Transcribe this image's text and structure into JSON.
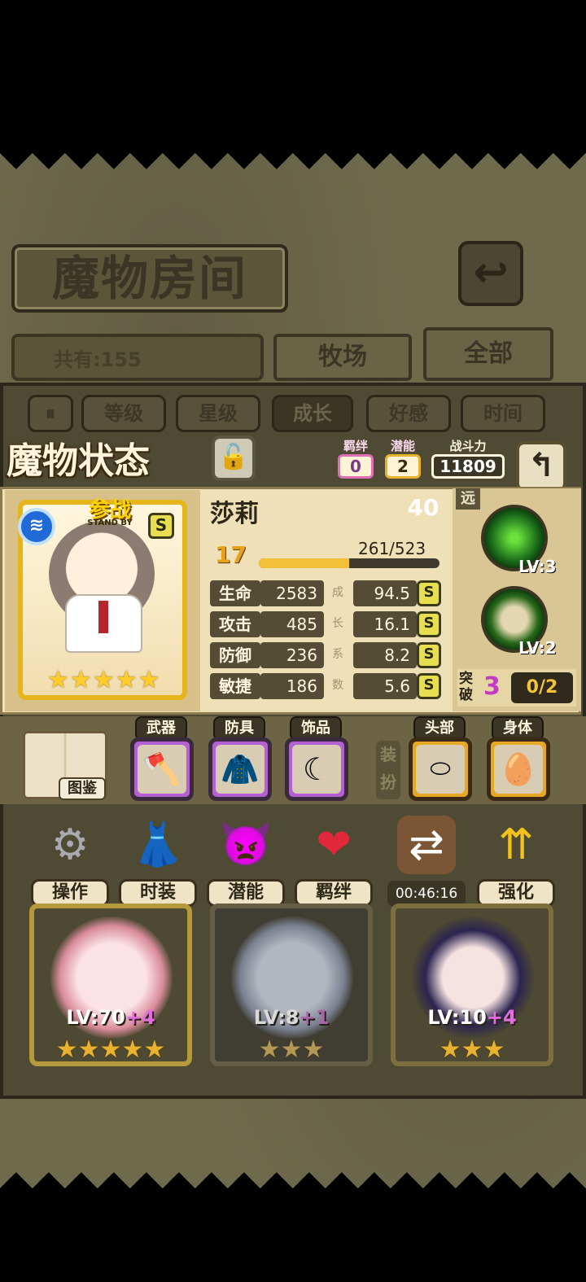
{
  "header": {
    "title": "魔物房间",
    "total_label": "共有:155",
    "tabs": [
      "牧场",
      "全部"
    ]
  },
  "sort_tabs": [
    "等级",
    "星级",
    "成长",
    "好感",
    "时间"
  ],
  "status": {
    "title": "魔物状态",
    "bond_label": "羁绊",
    "bond_value": "0",
    "potential_label": "潜能",
    "potential_value": "2",
    "power_label": "战斗力",
    "power_value": "11809"
  },
  "monster": {
    "standby_label": "参战",
    "standby_sub": "STAND BY",
    "element_icon": "water-icon",
    "rank": "S",
    "stars": 5,
    "name": "莎莉",
    "level": "40",
    "sub_level": "17",
    "exp_text": "261/523",
    "exp_progress": 0.5,
    "stats": [
      {
        "label": "生命",
        "value": "2583",
        "growth": "94.5",
        "grade": "S",
        "note": "成"
      },
      {
        "label": "攻击",
        "value": "485",
        "growth": "16.1",
        "grade": "S",
        "note": "长"
      },
      {
        "label": "防御",
        "value": "236",
        "growth": "8.2",
        "grade": "S",
        "note": "系"
      },
      {
        "label": "敏捷",
        "value": "186",
        "growth": "5.6",
        "grade": "S",
        "note": "数"
      }
    ],
    "range_label": "远",
    "skills": [
      {
        "name": "green-orb-skill",
        "level": "LV:3"
      },
      {
        "name": "drum-skill",
        "level": "LV:2"
      }
    ],
    "breakthrough_label": "突破",
    "breakthrough_value": "3",
    "breakthrough_progress": "0/2"
  },
  "equipment": {
    "book_label": "图鉴",
    "weapon_label": "武器",
    "armor_label": "防具",
    "accessory_label": "饰品",
    "equip_side_label": "装扮",
    "head_label": "头部",
    "body_label": "身体"
  },
  "actions": [
    {
      "label": "操作",
      "icon": "gear-icon"
    },
    {
      "label": "时装",
      "icon": "outfit-icon"
    },
    {
      "label": "潜能",
      "icon": "potential-icon"
    },
    {
      "label": "羁绊",
      "icon": "hearts-icon"
    },
    {
      "label": "00:46:16",
      "icon": "swap-icon"
    },
    {
      "label": "强化",
      "icon": "upgrade-icon"
    }
  ],
  "monster_list": [
    {
      "level": "LV:70",
      "plus": "+4",
      "stars": "★★★★★"
    },
    {
      "level": "LV:8",
      "plus": "+1",
      "stars": "★★★"
    },
    {
      "level": "LV:10",
      "plus": "+4",
      "stars": "★★★"
    }
  ],
  "colors": {
    "gold": "#e6b51c",
    "panel": "#efe0b8",
    "accent_pink": "#e06fb6",
    "heart_red": "#d8323b"
  }
}
